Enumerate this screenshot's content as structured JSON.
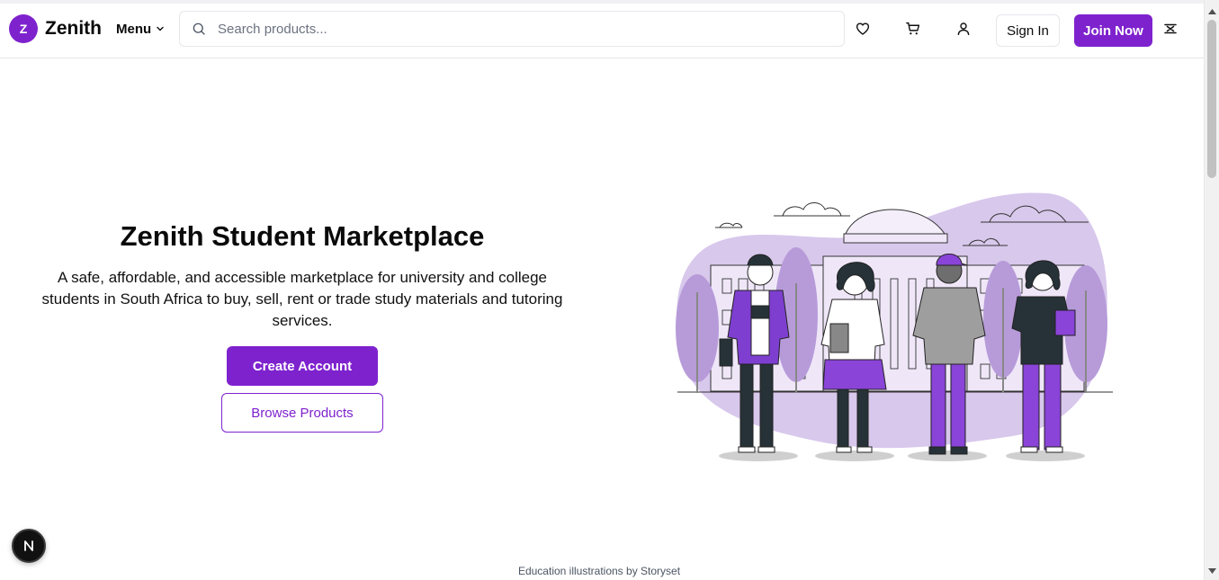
{
  "header": {
    "logo_letter": "Z",
    "brand": "Zenith",
    "menu_label": "Menu",
    "search_placeholder": "Search products...",
    "sign_in_label": "Sign In",
    "join_label": "Join Now",
    "icons": [
      "search-icon",
      "heart-icon",
      "cart-icon",
      "user-icon",
      "dev-tools-icon"
    ]
  },
  "hero": {
    "title": "Zenith Student Marketplace",
    "description": "A safe, affordable, and accessible marketplace for university and college students in South Africa to buy, sell, rent or trade study materials and tutoring services.",
    "primary_cta": "Create Account",
    "secondary_cta": "Browse Products"
  },
  "footer": {
    "credit": "Education illustrations by Storyset"
  },
  "badge": {
    "letter": "N"
  },
  "colors": {
    "brand": "#7e22ce",
    "brand_light": "#d8c8ec",
    "text": "#0a0a0a",
    "border": "#e5e7eb"
  }
}
